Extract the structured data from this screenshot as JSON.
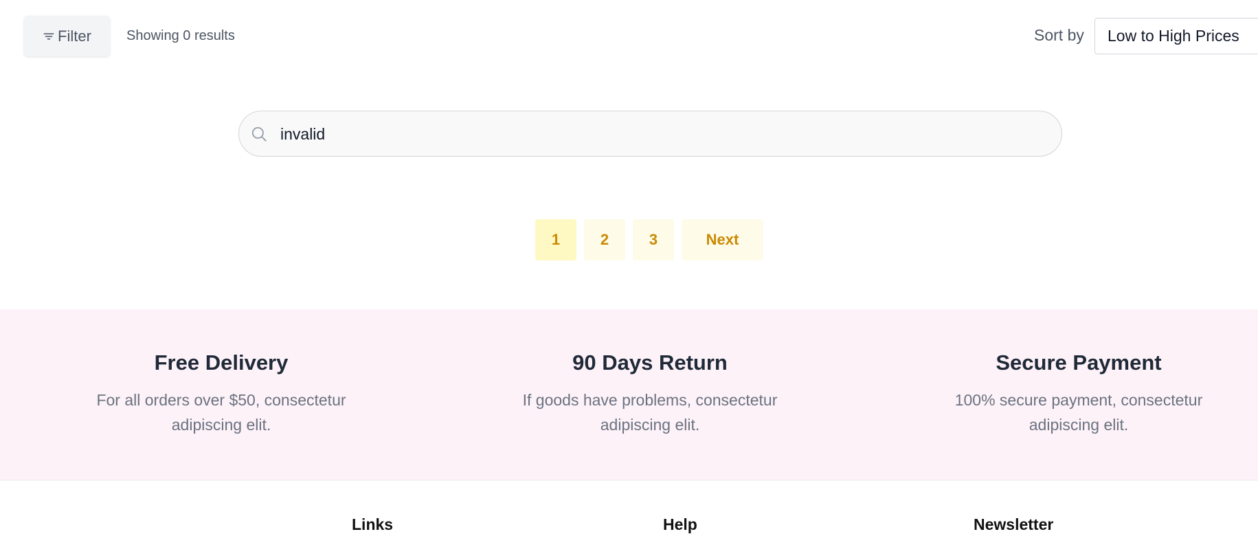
{
  "toolbar": {
    "filter_label": "Filter",
    "results_text": "Showing 0 results",
    "sort_label": "Sort by",
    "sort_value": "Low to High Prices"
  },
  "search": {
    "value": "invalid"
  },
  "pagination": {
    "pages": [
      "1",
      "2",
      "3"
    ],
    "next_label": "Next",
    "current_page": "1"
  },
  "features": [
    {
      "title": "Free Delivery",
      "line1": "For all orders over $50, consectetur",
      "line2": "adipiscing elit."
    },
    {
      "title": "90 Days Return",
      "line1": "If goods have problems, consectetur",
      "line2": "adipiscing elit."
    },
    {
      "title": "Secure Payment",
      "line1": "100% secure payment, consectetur",
      "line2": "adipiscing elit."
    }
  ],
  "footer": {
    "links_heading": "Links",
    "help_heading": "Help",
    "newsletter_heading": "Newsletter"
  },
  "icons": {
    "filter": "filter-icon",
    "search": "search-icon"
  },
  "colors": {
    "accent": "#ca8a04",
    "page_active_bg": "#fef9c3",
    "page_bg": "#fefbe8",
    "features_bg": "#fdf2f8"
  }
}
